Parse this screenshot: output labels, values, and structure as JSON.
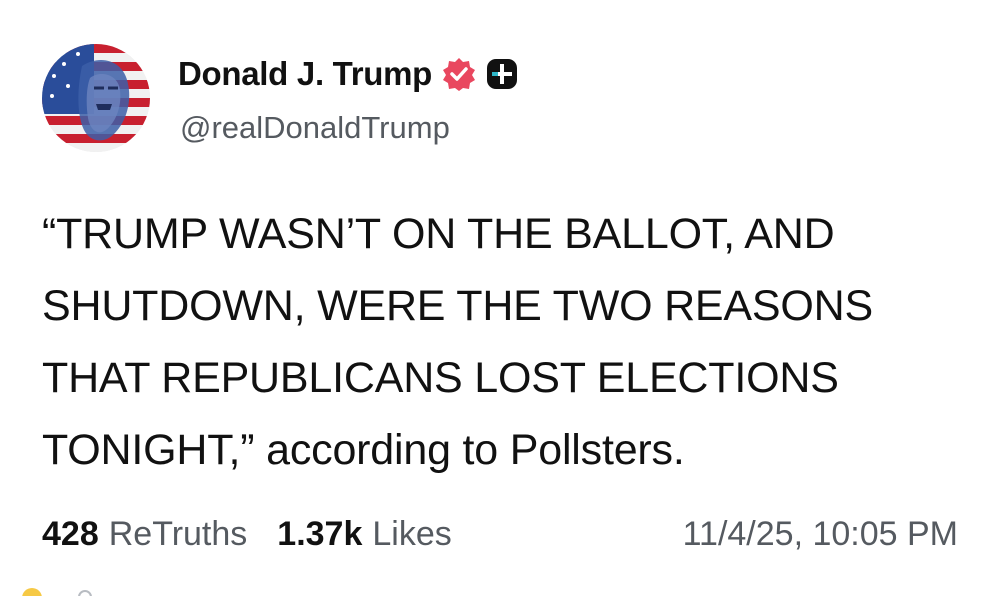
{
  "author": {
    "display_name": "Donald J. Trump",
    "handle": "@realDonaldTrump",
    "avatar_icon": "flag-portrait-avatar",
    "verified_icon": "verified-badge-icon",
    "verified_color": "#e9475f",
    "extra_badge_icon": "plus-badge-icon"
  },
  "post": {
    "lines": [
      "“TRUMP WASN’T ON THE BALLOT, AND",
      "SHUTDOWN, WERE THE TWO REASONS",
      "THAT REPUBLICANS LOST ELECTIONS",
      "TONIGHT,” according to Pollsters."
    ]
  },
  "stats": {
    "retruths_count": "428",
    "retruths_label": "ReTruths",
    "likes_count": "1.37k",
    "likes_label": "Likes",
    "timestamp": "11/4/25, 10:05 PM"
  },
  "colors": {
    "text": "#111111",
    "secondary_text": "#555a60",
    "background": "#ffffff"
  }
}
